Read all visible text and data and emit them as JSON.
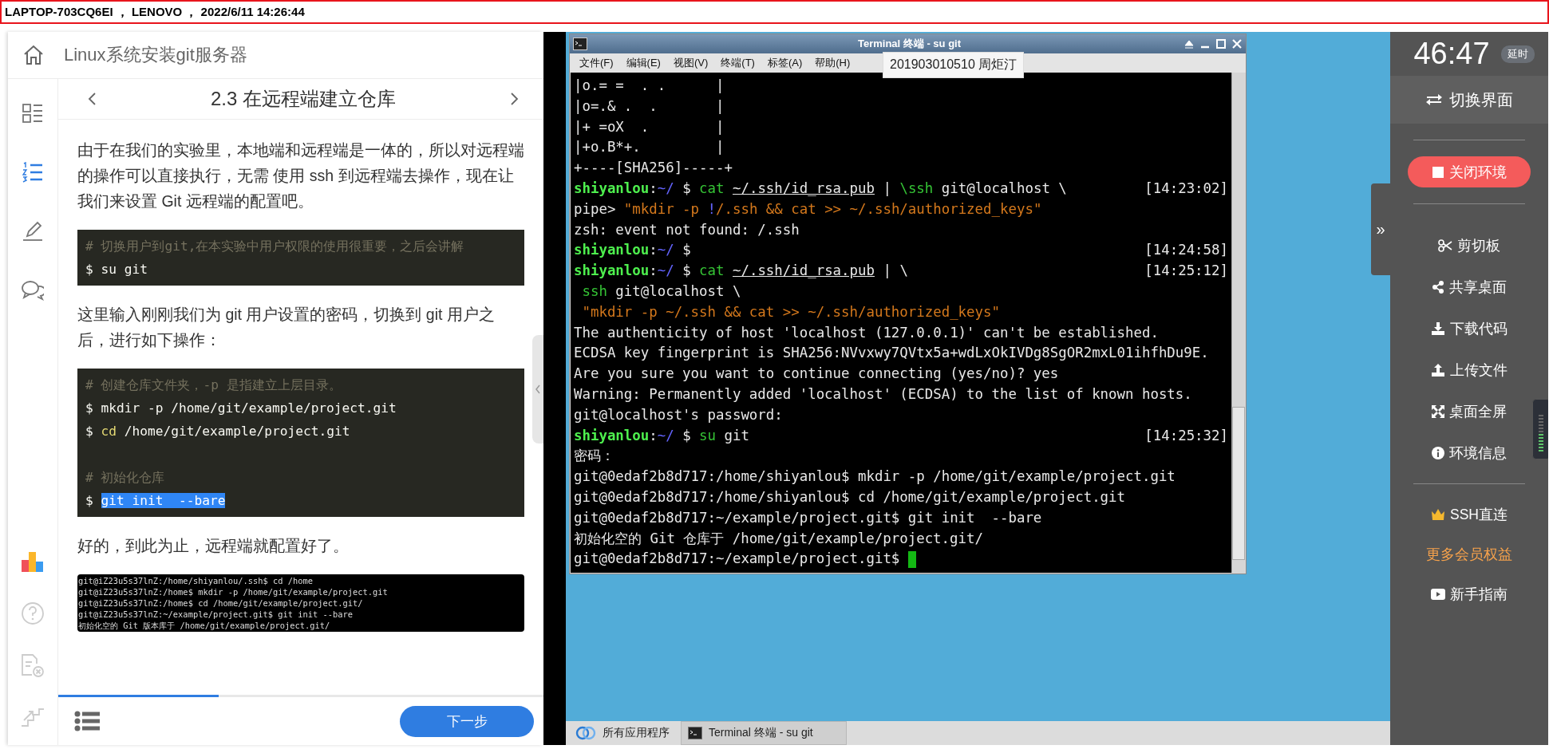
{
  "top_bar": {
    "text": "LAPTOP-703CQ6EI ， LENOVO ， 2022/6/11 14:26:44"
  },
  "course": {
    "title": "Linux系统安装git服务器",
    "rail": [
      {
        "kind": "catalog",
        "selected": false
      },
      {
        "kind": "steps",
        "selected": true
      },
      {
        "kind": "notes",
        "selected": false
      },
      {
        "kind": "comments",
        "selected": false
      }
    ],
    "rail_bottom": [
      {
        "kind": "ranking"
      },
      {
        "kind": "help"
      },
      {
        "kind": "report"
      },
      {
        "kind": "stairs"
      }
    ],
    "section_title": "2.3 在远程端建立仓库",
    "blocks": [
      {
        "kind": "paragraph",
        "text": "由于在我们的实验里，本地端和远程端是一体的，所以对远程端的操作可以直接执行，无需 使用 ssh 到远程端去操作，现在让我们来设置 Git 远程端的配置吧。"
      },
      {
        "kind": "code",
        "sections": [
          [
            [
              {
                "text": "# 切换用户到git,在本实验中用户权限的使用很重要，之后会讲解",
                "kind": "comment"
              }
            ],
            [
              {
                "text": "$ su git",
                "kind": "plain"
              }
            ]
          ]
        ]
      },
      {
        "kind": "paragraph",
        "text": "这里输入刚刚我们为 git 用户设置的密码，切换到 git 用户之后，进行如下操作："
      },
      {
        "kind": "code",
        "sections": [
          [
            [
              {
                "text": "# 创建仓库文件夹，-p 是指建立上层目录。",
                "kind": "comment"
              }
            ],
            [
              {
                "text": "$ mkdir -p /home/git/example/project.git",
                "kind": "plain"
              }
            ],
            [
              {
                "text": "$ ",
                "kind": "plain"
              },
              {
                "text": "cd",
                "kind": "keyword"
              },
              {
                "text": " /home/git/example/project.git",
                "kind": "plain"
              }
            ]
          ],
          [
            [
              {
                "text": "# 初始化仓库",
                "kind": "comment"
              }
            ],
            [
              {
                "text": "$ ",
                "kind": "plain"
              },
              {
                "text": "git init  --bare",
                "kind": "selection"
              }
            ]
          ]
        ]
      },
      {
        "kind": "paragraph",
        "text": "好的，到此为止，远程端就配置好了。"
      },
      {
        "kind": "screenshot",
        "lines": [
          "git@iZ23u5s37lnZ:/home/shiyanlou/.ssh$ cd /home",
          "git@iZ23u5s37lnZ:/home$ mkdir -p /home/git/example/project.git",
          "git@iZ23u5s37lnZ:/home$ cd /home/git/example/project.git/",
          "git@iZ23u5s37lnZ:~/example/project.git$ git init --bare",
          "初始化空的 Git 版本库于 /home/git/example/project.git/"
        ]
      }
    ],
    "progress": {
      "level": 0.33
    },
    "next_button": "下一步"
  },
  "terminal": {
    "title": "Terminal 终端 - su git",
    "menu": [
      "文件(F)",
      "编辑(E)",
      "视图(V)",
      "终端(T)",
      "标签(A)",
      "帮助(H)"
    ],
    "tooltip": "201903010510 周炬汀",
    "lines": [
      {
        "segments": [
          {
            "text": "|o.= =  . .      |",
            "kind": "plain"
          }
        ]
      },
      {
        "segments": [
          {
            "text": "|o=.& .  .       |",
            "kind": "plain"
          }
        ]
      },
      {
        "segments": [
          {
            "text": "|+ =oX  .        |",
            "kind": "plain"
          }
        ]
      },
      {
        "segments": [
          {
            "text": "|+o.B*+.         |",
            "kind": "plain"
          }
        ]
      },
      {
        "segments": [
          {
            "text": "+----[SHA256]-----+",
            "kind": "plain"
          }
        ]
      },
      {
        "segments": [
          {
            "text": "shiyanlou",
            "kind": "user"
          },
          {
            "text": ":",
            "kind": "plain"
          },
          {
            "text": "~/",
            "kind": "path"
          },
          {
            "text": " $ ",
            "kind": "plain"
          },
          {
            "text": "cat ",
            "kind": "cmd"
          },
          {
            "text": "~/.ssh/id_rsa.pub",
            "kind": "underline"
          },
          {
            "text": " | ",
            "kind": "plain"
          },
          {
            "text": "\\ssh",
            "kind": "cmd"
          },
          {
            "text": " git@localhost \\",
            "kind": "plain"
          }
        ],
        "time": "[14:23:02]"
      },
      {
        "segments": [
          {
            "text": "pipe> ",
            "kind": "plain"
          },
          {
            "text": "\"mkdir -p ",
            "kind": "string"
          },
          {
            "text": "!",
            "kind": "path"
          },
          {
            "text": "/.ssh && cat >> ~/.ssh/authorized_keys\"",
            "kind": "string"
          }
        ]
      },
      {
        "segments": [
          {
            "text": "zsh: event not found: /.ssh",
            "kind": "plain"
          }
        ]
      },
      {
        "segments": [
          {
            "text": "shiyanlou",
            "kind": "user"
          },
          {
            "text": ":",
            "kind": "plain"
          },
          {
            "text": "~/",
            "kind": "path"
          },
          {
            "text": " $",
            "kind": "plain"
          }
        ],
        "time": "[14:24:58]"
      },
      {
        "segments": [
          {
            "text": "shiyanlou",
            "kind": "user"
          },
          {
            "text": ":",
            "kind": "plain"
          },
          {
            "text": "~/",
            "kind": "path"
          },
          {
            "text": " $ ",
            "kind": "plain"
          },
          {
            "text": "cat ",
            "kind": "cmd"
          },
          {
            "text": "~/.ssh/id_rsa.pub",
            "kind": "underline"
          },
          {
            "text": " | \\",
            "kind": "plain"
          }
        ],
        "time": "[14:25:12]"
      },
      {
        "segments": [
          {
            "text": " ssh",
            "kind": "cmd"
          },
          {
            "text": " git@localhost \\",
            "kind": "plain"
          }
        ]
      },
      {
        "segments": [
          {
            "text": " \"mkdir -p ~/.ssh && cat >> ~/.ssh/authorized_keys\"",
            "kind": "string"
          }
        ]
      },
      {
        "segments": [
          {
            "text": "The authenticity of host 'localhost (127.0.0.1)' can't be established.",
            "kind": "plain"
          }
        ]
      },
      {
        "segments": [
          {
            "text": "ECDSA key fingerprint is SHA256:NVvxwy7QVtx5a+wdLxOkIVDg8SgOR2mxL01ihfhDu9E.",
            "kind": "plain"
          }
        ]
      },
      {
        "segments": [
          {
            "text": "Are you sure you want to continue connecting (yes/no)? yes",
            "kind": "plain"
          }
        ]
      },
      {
        "segments": [
          {
            "text": "Warning: Permanently added 'localhost' (ECDSA) to the list of known hosts.",
            "kind": "plain"
          }
        ]
      },
      {
        "segments": [
          {
            "text": "git@localhost's password:",
            "kind": "plain"
          }
        ]
      },
      {
        "segments": [
          {
            "text": "shiyanlou",
            "kind": "user"
          },
          {
            "text": ":",
            "kind": "plain"
          },
          {
            "text": "~/",
            "kind": "path"
          },
          {
            "text": " $ ",
            "kind": "plain"
          },
          {
            "text": "su",
            "kind": "cmd"
          },
          {
            "text": " git",
            "kind": "plain"
          }
        ],
        "time": "[14:25:32]"
      },
      {
        "segments": [
          {
            "text": "密码：",
            "kind": "plain"
          }
        ]
      },
      {
        "segments": [
          {
            "text": "git@0edaf2b8d717:/home/shiyanlou$ mkdir -p /home/git/example/project.git",
            "kind": "plain"
          }
        ]
      },
      {
        "segments": [
          {
            "text": "git@0edaf2b8d717:/home/shiyanlou$ cd /home/git/example/project.git",
            "kind": "plain"
          }
        ]
      },
      {
        "segments": [
          {
            "text": "git@0edaf2b8d717:~/example/project.git$ git init  --bare",
            "kind": "plain"
          }
        ]
      },
      {
        "segments": [
          {
            "text": "初始化空的 Git 仓库于 /home/git/example/project.git/",
            "kind": "plain"
          }
        ]
      },
      {
        "segments": [
          {
            "text": "git@0edaf2b8d717:~/example/project.git$ ",
            "kind": "plain"
          }
        ],
        "cursor": true
      }
    ]
  },
  "taskbar": [
    {
      "kind": "apps",
      "label": "所有应用程序"
    },
    {
      "kind": "terminal",
      "label": "Terminal 终端 - su git"
    }
  ],
  "sidebar": {
    "collapse_tab": "»",
    "timer": "46:47",
    "extend_badge": "延时",
    "switch_button": "切换界面",
    "close_button": "关闭环境",
    "tools": [
      {
        "kind": "clipboard",
        "label": "剪切板"
      },
      {
        "kind": "share",
        "label": "共享桌面"
      },
      {
        "kind": "download",
        "label": "下载代码"
      },
      {
        "kind": "upload",
        "label": "上传文件"
      },
      {
        "kind": "fullscreen",
        "label": "桌面全屏"
      },
      {
        "kind": "info",
        "label": "环境信息"
      }
    ],
    "extras": [
      {
        "kind": "ssh",
        "label": "SSH直连"
      },
      {
        "kind": "membership",
        "label": "更多会员权益"
      },
      {
        "kind": "guide",
        "label": "新手指南"
      }
    ]
  }
}
